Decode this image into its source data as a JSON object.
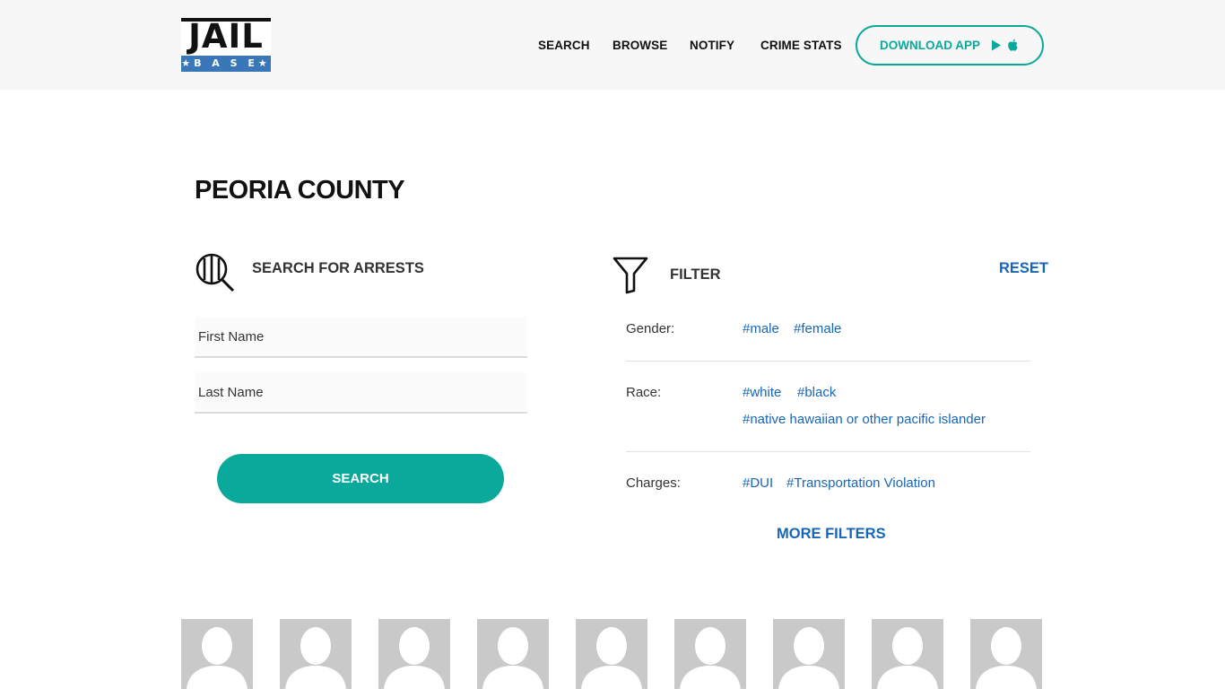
{
  "logo": {
    "word": "JAIL",
    "sub": "BASE",
    "sub_decorated": "★B A S E★"
  },
  "nav": {
    "items": [
      "SEARCH",
      "BROWSE",
      "NOTIFY",
      "CRIME STATS"
    ],
    "download_label": "DOWNLOAD APP",
    "download_icons": [
      "play-store-icon",
      "apple-icon"
    ]
  },
  "page_title": "PEORIA COUNTY",
  "search": {
    "heading": "SEARCH FOR ARRESTS",
    "first_name_placeholder": "First Name",
    "last_name_placeholder": "Last Name",
    "button_label": "SEARCH"
  },
  "filter": {
    "heading": "FILTER",
    "reset_label": "RESET",
    "gender_label": "Gender:",
    "gender_tags": [
      "#male",
      "#female"
    ],
    "race_label": "Race:",
    "race_tags": [
      "#white",
      "#black",
      "#native hawaiian or other pacific islander"
    ],
    "charges_label": "Charges:",
    "charges_tags": [
      "#DUI",
      "#Transportation Violation"
    ],
    "more_label": "MORE FILTERS"
  },
  "colors": {
    "accent": "#0aa99c",
    "link": "#1766b8",
    "logo_blue": "#3a77b9",
    "placeholder_avatar": "#c9c9c9"
  },
  "avatars_count": 9
}
